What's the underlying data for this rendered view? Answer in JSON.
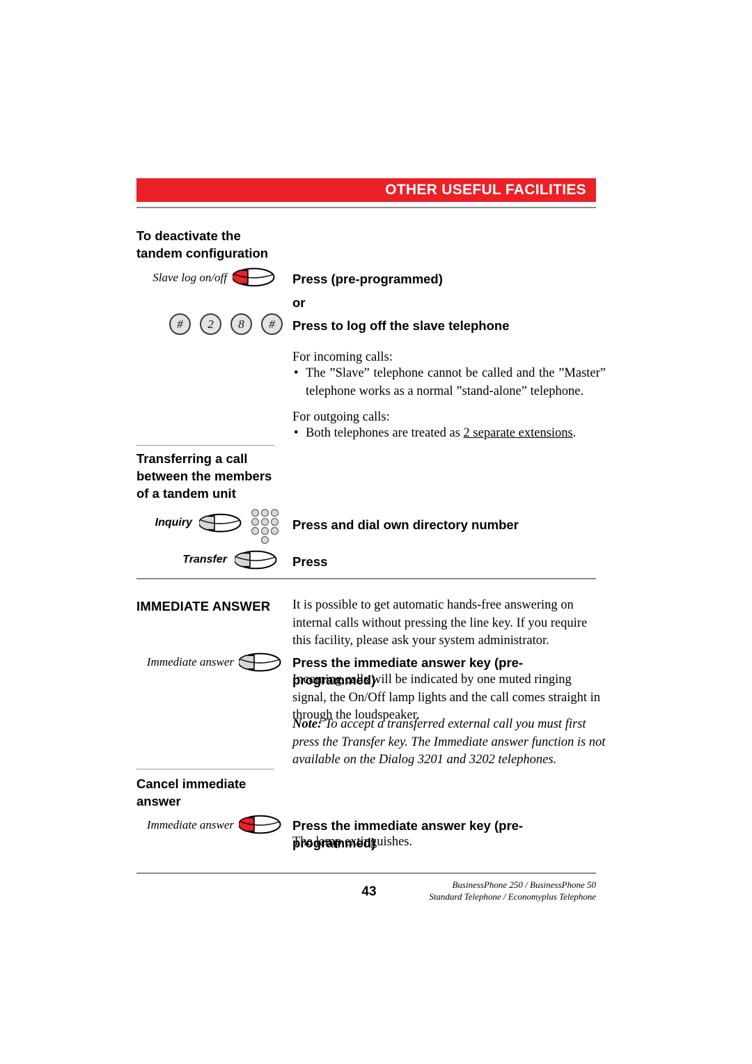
{
  "header": {
    "title": "OTHER USEFUL FACILITIES",
    "accent_color": "#ec2027"
  },
  "sections": [
    {
      "id": "deactivate-tandem",
      "heading": "To deactivate the\ntandem configuration",
      "steps": [
        {
          "key_label": "Slave log on/off",
          "key_type": "oval-lamp-key",
          "lamp": "red",
          "instruction": "Press (pre-programmed)"
        },
        {
          "connector": "or"
        },
        {
          "key_label": "",
          "key_type": "digit-keys",
          "digits": [
            "#",
            "2",
            "8",
            "#"
          ],
          "instruction": "Press to log off the slave telephone"
        }
      ],
      "body": {
        "incoming_heading": "For incoming calls:",
        "incoming_bullets": [
          "The ”Slave” telephone cannot be called and the ”Master” telephone works as a normal ”stand-alone” telephone."
        ],
        "outgoing_heading": "For outgoing calls:",
        "outgoing_bullet_pre": "Both telephones are treated as ",
        "outgoing_bullet_underlined": "2 separate extensions",
        "outgoing_bullet_post": "."
      }
    },
    {
      "id": "transferring-call",
      "heading": "Transferring a call\nbetween the members\nof a tandem unit",
      "steps": [
        {
          "key_label": "Inquiry",
          "key_type": "oval-lamp-key",
          "lamp": "grey",
          "extra_icon": "keypad-icon",
          "instruction": "Press and dial own directory number"
        },
        {
          "key_label": "Transfer",
          "key_type": "oval-lamp-key",
          "lamp": "grey",
          "instruction": "Press"
        }
      ]
    },
    {
      "id": "immediate-answer",
      "heading": "IMMEDIATE ANSWER",
      "intro": "It is possible to get automatic hands-free answering on internal calls without pressing the line key. If you require this facility, please ask your system administrator.",
      "steps": [
        {
          "key_label": "Immediate answer",
          "key_type": "oval-lamp-key",
          "lamp": "grey",
          "instruction": "Press the immediate answer key (pre-programmed)"
        }
      ],
      "body": "Incoming calls will be indicated by one muted ringing signal, the On/Off lamp lights and the call comes straight in through the loudspeaker.",
      "note_lead": "Note:",
      "note_text": " To accept a transferred external call you must first press the Transfer key. The Immediate answer function is not available on the Dialog 3201 and 3202 telephones."
    },
    {
      "id": "cancel-immediate-answer",
      "heading": "Cancel immediate\nanswer",
      "steps": [
        {
          "key_label": "Immediate answer",
          "key_type": "oval-lamp-key",
          "lamp": "red",
          "instruction": "Press the immediate answer key (pre-programmed)"
        }
      ],
      "body": "The lamp extinguishes."
    }
  ],
  "footer": {
    "page_number": "43",
    "line1": "BusinessPhone 250 / BusinessPhone 50",
    "line2": "Standard Telephone / Economyplus Telephone"
  }
}
